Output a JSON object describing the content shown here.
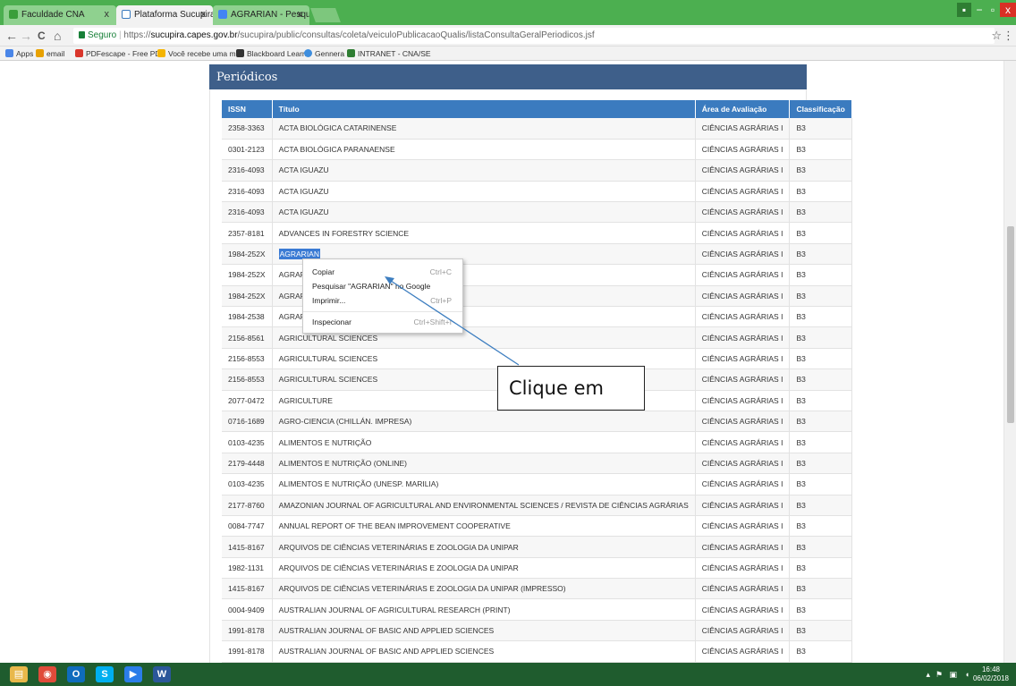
{
  "browser": {
    "tabs": [
      {
        "label": "Faculdade CNA",
        "active": false
      },
      {
        "label": "Plataforma Sucupira",
        "active": true
      },
      {
        "label": "AGRARIAN - Pesquisa G",
        "active": false
      }
    ],
    "tab_close": "x",
    "window_controls": {
      "minimize": "−",
      "restore": "▫",
      "close": "x"
    },
    "nav": {
      "back": "←",
      "forward": "→",
      "reload": "C",
      "home": "⌂"
    },
    "address": {
      "secure_label": "Seguro",
      "scheme": "https://",
      "host": "sucupira.capes.gov.br",
      "path": "/sucupira/public/consultas/coleta/veiculoPublicacaoQualis/listaConsultaGeralPeriodicos.jsf"
    },
    "bookmark_star": "☆",
    "menu": "⋮",
    "bookmarks": [
      {
        "label": "Apps",
        "color": "#4a86e8"
      },
      {
        "label": "email",
        "color": "#e8a100"
      },
      {
        "label": "PDFescape - Free PD",
        "color": "#d9362b"
      },
      {
        "label": "Você recebe uma me",
        "color": "#f4b400"
      },
      {
        "label": "Blackboard Learn",
        "color": "#333333"
      },
      {
        "label": "Gennera",
        "color": "#3e8ede"
      },
      {
        "label": "INTRANET - CNA/SE",
        "color": "#2e7d32"
      }
    ]
  },
  "panel": {
    "title": "Periódicos"
  },
  "table": {
    "headers": [
      "ISSN",
      "Título",
      "Área de Avaliação",
      "Classificação"
    ],
    "rows": [
      [
        "2358-3363",
        "ACTA BIOLÓGICA CATARINENSE",
        "CIÊNCIAS AGRÁRIAS I",
        "B3"
      ],
      [
        "0301-2123",
        "ACTA BIOLÓGICA PARANAENSE",
        "CIÊNCIAS AGRÁRIAS I",
        "B3"
      ],
      [
        "2316-4093",
        "ACTA IGUAZU",
        "CIÊNCIAS AGRÁRIAS I",
        "B3"
      ],
      [
        "2316-4093",
        "ACTA IGUAZU",
        "CIÊNCIAS AGRÁRIAS I",
        "B3"
      ],
      [
        "2316-4093",
        "ACTA IGUAZU",
        "CIÊNCIAS AGRÁRIAS I",
        "B3"
      ],
      [
        "2357-8181",
        "ADVANCES IN FORESTRY SCIENCE",
        "CIÊNCIAS AGRÁRIAS I",
        "B3"
      ],
      [
        "1984-252X",
        "AGRARIAN",
        "CIÊNCIAS AGRÁRIAS I",
        "B3"
      ],
      [
        "1984-252X",
        "AGRARIAN",
        "CIÊNCIAS AGRÁRIAS I",
        "B3"
      ],
      [
        "1984-252X",
        "AGRARIAN",
        "CIÊNCIAS AGRÁRIAS I",
        "B3"
      ],
      [
        "1984-2538",
        "AGRARIAN",
        "CIÊNCIAS AGRÁRIAS I",
        "B3"
      ],
      [
        "2156-8561",
        "AGRICULTURAL SCIENCES",
        "CIÊNCIAS AGRÁRIAS I",
        "B3"
      ],
      [
        "2156-8553",
        "AGRICULTURAL SCIENCES",
        "CIÊNCIAS AGRÁRIAS I",
        "B3"
      ],
      [
        "2156-8553",
        "AGRICULTURAL SCIENCES",
        "CIÊNCIAS AGRÁRIAS I",
        "B3"
      ],
      [
        "2077-0472",
        "AGRICULTURE",
        "CIÊNCIAS AGRÁRIAS I",
        "B3"
      ],
      [
        "0716-1689",
        "AGRO-CIENCIA (CHILLÁN. IMPRESA)",
        "CIÊNCIAS AGRÁRIAS I",
        "B3"
      ],
      [
        "0103-4235",
        "ALIMENTOS E NUTRIÇÃO",
        "CIÊNCIAS AGRÁRIAS I",
        "B3"
      ],
      [
        "2179-4448",
        "ALIMENTOS E NUTRIÇÃO (ONLINE)",
        "CIÊNCIAS AGRÁRIAS I",
        "B3"
      ],
      [
        "0103-4235",
        "ALIMENTOS E NUTRIÇÃO (UNESP. MARILIA)",
        "CIÊNCIAS AGRÁRIAS I",
        "B3"
      ],
      [
        "2177-8760",
        "AMAZONIAN JOURNAL OF AGRICULTURAL AND ENVIRONMENTAL SCIENCES / REVISTA DE CIÊNCIAS AGRÁRIAS",
        "CIÊNCIAS AGRÁRIAS I",
        "B3"
      ],
      [
        "0084-7747",
        "ANNUAL REPORT OF THE BEAN IMPROVEMENT COOPERATIVE",
        "CIÊNCIAS AGRÁRIAS I",
        "B3"
      ],
      [
        "1415-8167",
        "ARQUIVOS DE CIÊNCIAS VETERINÁRIAS E ZOOLOGIA DA UNIPAR",
        "CIÊNCIAS AGRÁRIAS I",
        "B3"
      ],
      [
        "1982-1131",
        "ARQUIVOS DE CIÊNCIAS VETERINÁRIAS E ZOOLOGIA DA UNIPAR",
        "CIÊNCIAS AGRÁRIAS I",
        "B3"
      ],
      [
        "1415-8167",
        "ARQUIVOS DE CIÊNCIAS VETERINÁRIAS E ZOOLOGIA DA UNIPAR (IMPRESSO)",
        "CIÊNCIAS AGRÁRIAS I",
        "B3"
      ],
      [
        "0004-9409",
        "AUSTRALIAN JOURNAL OF AGRICULTURAL RESEARCH (PRINT)",
        "CIÊNCIAS AGRÁRIAS I",
        "B3"
      ],
      [
        "1991-8178",
        "AUSTRALIAN JOURNAL OF BASIC AND APPLIED SCIENCES",
        "CIÊNCIAS AGRÁRIAS I",
        "B3"
      ],
      [
        "1991-8178",
        "AUSTRALIAN JOURNAL OF BASIC AND APPLIED SCIENCES",
        "CIÊNCIAS AGRÁRIAS I",
        "B3"
      ]
    ]
  },
  "context_menu": {
    "items": [
      {
        "label": "Copiar",
        "shortcut": "Ctrl+C"
      },
      {
        "label": "Pesquisar \"AGRARIAN\" no Google",
        "shortcut": ""
      },
      {
        "label": "Imprimir...",
        "shortcut": "Ctrl+P"
      },
      {
        "label": "Inspecionar",
        "shortcut": "Ctrl+Shift+I"
      }
    ]
  },
  "annotation": {
    "text": "Clique em"
  },
  "taskbar": {
    "apps": [
      {
        "name": "file-explorer",
        "glyph": "▤",
        "color": "#e8b84a"
      },
      {
        "name": "chrome",
        "glyph": "◉",
        "color": "#e04b3a"
      },
      {
        "name": "outlook",
        "glyph": "O",
        "color": "#0f6cbd"
      },
      {
        "name": "skype",
        "glyph": "S",
        "color": "#00aff0"
      },
      {
        "name": "media",
        "glyph": "▶",
        "color": "#2b7de9"
      },
      {
        "name": "word",
        "glyph": "W",
        "color": "#2b579a"
      }
    ],
    "time": "16:48",
    "date": "06/02/2018"
  }
}
